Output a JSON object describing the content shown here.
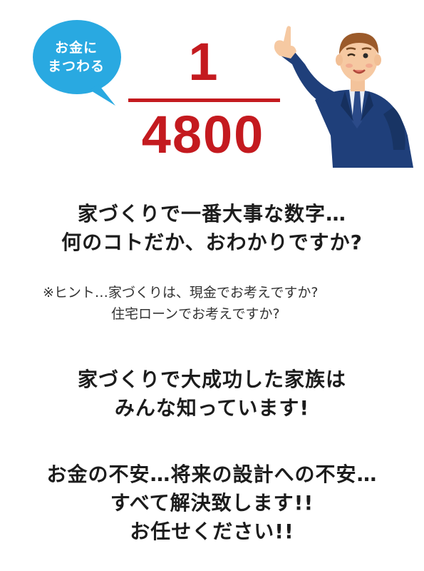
{
  "bubble": {
    "line1": "お金に",
    "line2": "まつわる",
    "color": "#29a9e1"
  },
  "fraction": {
    "numerator": "1",
    "denominator": "4800",
    "color": "#c41a1f"
  },
  "question": {
    "line1": "家づくりで一番大事な数字…",
    "line2": "何のコトだか、おわかりですか?"
  },
  "hint": {
    "line1": "※ヒント…家づくりは、現金でお考えですか?",
    "line2": "住宅ローンでお考えですか?"
  },
  "answer": {
    "line1": "家づくりで大成功した家族は",
    "line2": "みんな知っています!"
  },
  "closing": {
    "line1": "お金の不安…将来の設計への不安…",
    "line2": "すべて解決致します!!",
    "line3": "お任せください!!"
  },
  "icons": {
    "character": "businessman-pointing-icon"
  }
}
